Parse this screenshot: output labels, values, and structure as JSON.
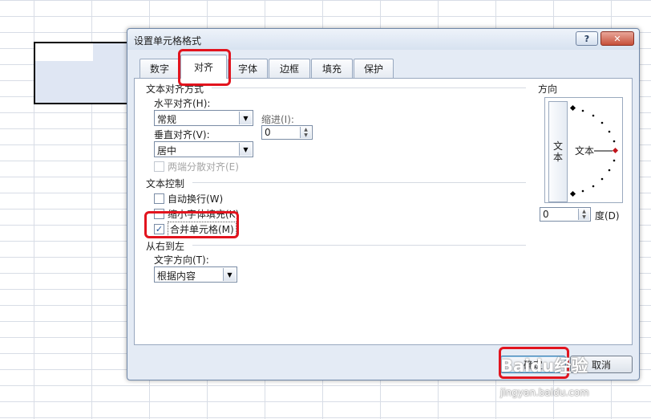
{
  "dialog": {
    "title": "设置单元格格式",
    "help_label": "?",
    "close_label": "✕"
  },
  "tabs": [
    {
      "label": "数字"
    },
    {
      "label": "对齐"
    },
    {
      "label": "字体"
    },
    {
      "label": "边框"
    },
    {
      "label": "填充"
    },
    {
      "label": "保护"
    }
  ],
  "alignment": {
    "section_title": "文本对齐方式",
    "horizontal_label": "水平对齐(H):",
    "horizontal_value": "常规",
    "indent_label": "缩进(I):",
    "indent_value": "0",
    "vertical_label": "垂直对齐(V):",
    "vertical_value": "居中",
    "distributed_label": "两端分散对齐(E)"
  },
  "text_control": {
    "section_title": "文本控制",
    "wrap_label": "自动换行(W)",
    "shrink_label": "缩小字体填充(K)",
    "merge_label": "合并单元格(M)",
    "merge_checkmark": "✓"
  },
  "rtl": {
    "section_title": "从右到左",
    "direction_label": "文字方向(T):",
    "direction_value": "根据内容"
  },
  "orientation": {
    "title": "方向",
    "vertical_text_1": "文",
    "vertical_text_2": "本",
    "text_label": "文本",
    "degrees_value": "0",
    "degrees_label": "度(D)"
  },
  "buttons": {
    "ok_label": "确定",
    "cancel_label": "取消"
  },
  "watermark": {
    "brand": "Baidu经验",
    "url": "jingyan.baidu.com"
  },
  "colors": {
    "highlight": "#e2141e",
    "dialog_bg": "#e4ebf5",
    "orientation_dot": "#c0141c"
  }
}
